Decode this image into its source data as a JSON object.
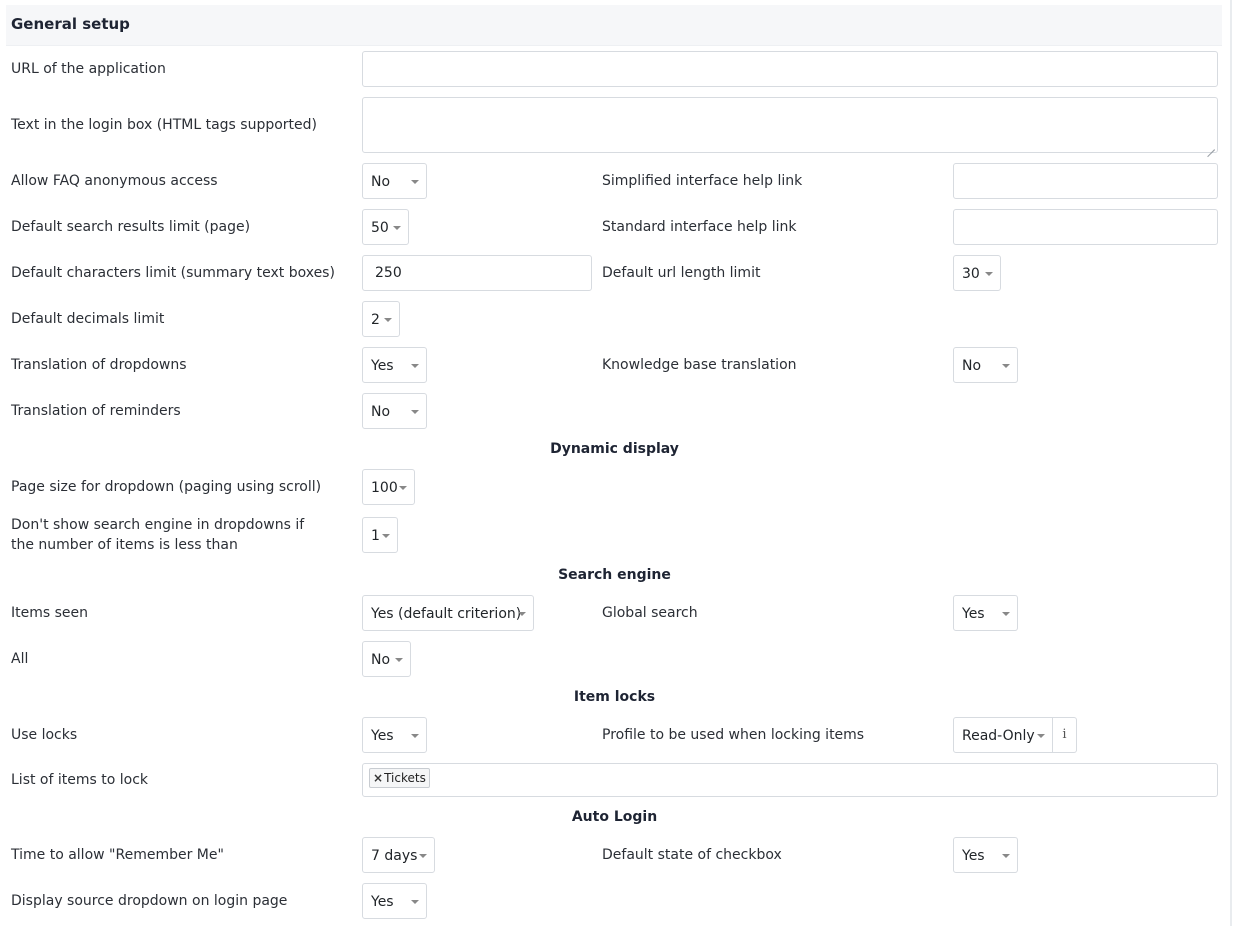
{
  "header": {
    "title": "General setup"
  },
  "fields": {
    "url_label": "URL of the application",
    "url_value": "",
    "login_text_label": "Text in the login box (HTML tags supported)",
    "login_text_value": "",
    "faq_label": "Allow FAQ anonymous access",
    "faq_value": "No",
    "simplified_help_label": "Simplified interface help link",
    "simplified_help_value": "",
    "search_limit_label": "Default search results limit (page)",
    "search_limit_value": "50",
    "standard_help_label": "Standard interface help link",
    "standard_help_value": "",
    "chars_limit_label": "Default characters limit (summary text boxes)",
    "chars_limit_value": "250",
    "url_length_label": "Default url length limit",
    "url_length_value": "30",
    "decimals_label": "Default decimals limit",
    "decimals_value": "2",
    "translate_dropdowns_label": "Translation of dropdowns",
    "translate_dropdowns_value": "Yes",
    "kb_translation_label": "Knowledge base translation",
    "kb_translation_value": "No",
    "translate_reminders_label": "Translation of reminders",
    "translate_reminders_value": "No"
  },
  "dynamic_display": {
    "title": "Dynamic display",
    "page_size_label": "Page size for dropdown (paging using scroll)",
    "page_size_value": "100",
    "search_engine_threshold_label": "Don't show search engine in dropdowns if the number of items is less than",
    "search_engine_threshold_value": "1"
  },
  "search_engine": {
    "title": "Search engine",
    "items_seen_label": "Items seen",
    "items_seen_value": "Yes (default criterion)",
    "global_search_label": "Global search",
    "global_search_value": "Yes",
    "all_label": "All",
    "all_value": "No"
  },
  "item_locks": {
    "title": "Item locks",
    "use_locks_label": "Use locks",
    "use_locks_value": "Yes",
    "profile_label": "Profile to be used when locking items",
    "profile_value": "Read-Only",
    "info_glyph": "i",
    "list_label": "List of items to lock",
    "tag_remove": "×",
    "tags": [
      "Tickets"
    ]
  },
  "auto_login": {
    "title": "Auto Login",
    "remember_label": "Time to allow \"Remember Me\"",
    "remember_value": "7 days",
    "checkbox_state_label": "Default state of checkbox",
    "checkbox_state_value": "Yes",
    "source_dropdown_label": "Display source dropdown on login page",
    "source_dropdown_value": "Yes"
  }
}
